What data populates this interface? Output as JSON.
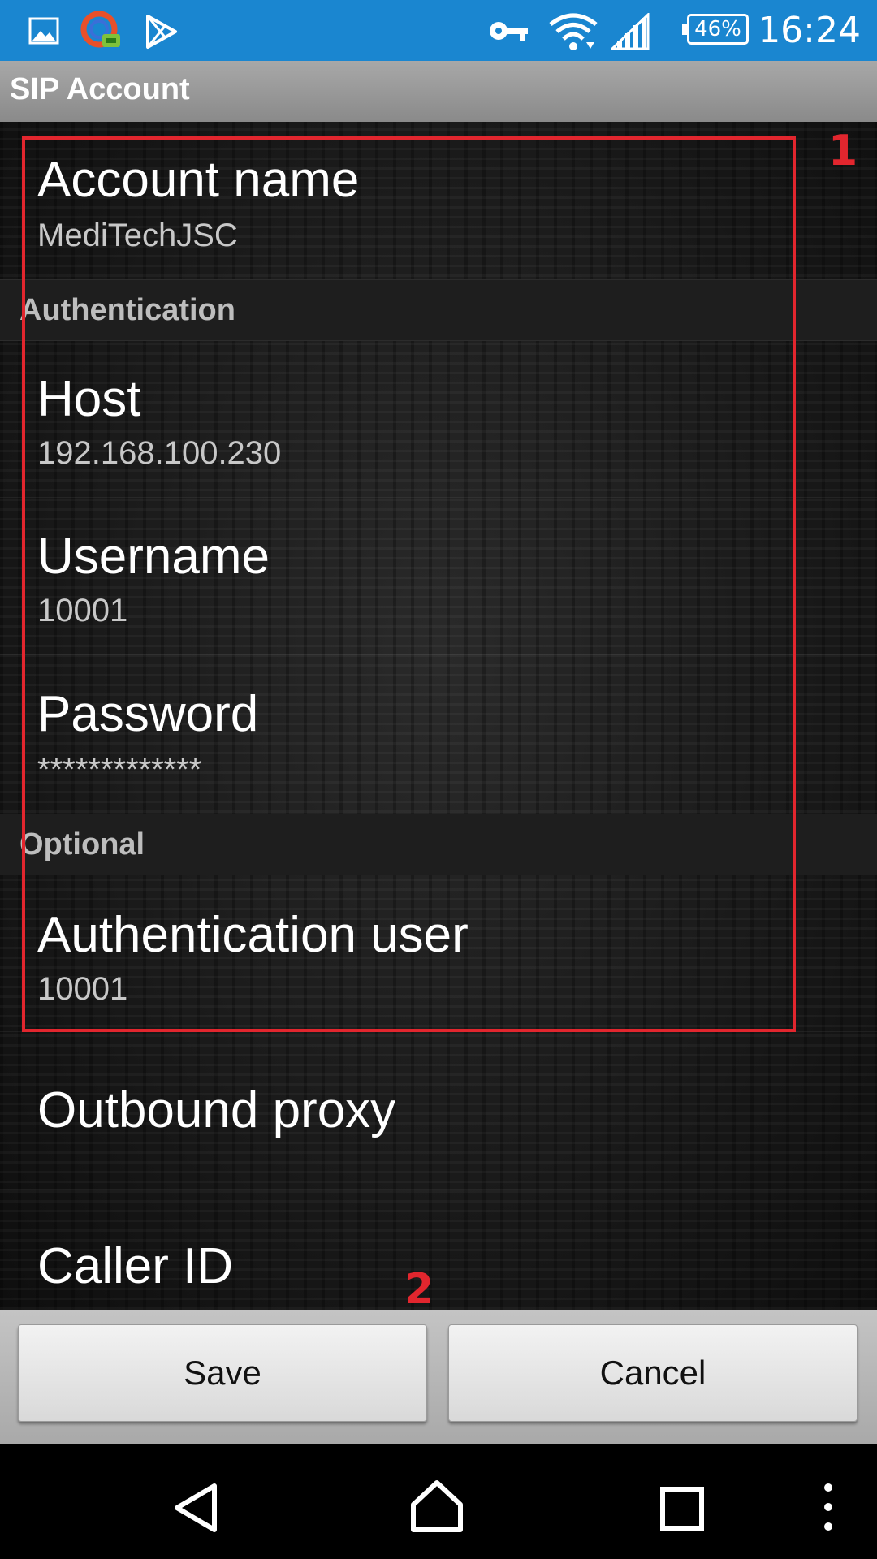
{
  "status_bar": {
    "time": "16:24",
    "battery": "46%",
    "left_icons": [
      "gallery-icon",
      "vpn-app-icon",
      "play-store-icon"
    ],
    "right_icons": [
      "key-icon",
      "wifi-icon",
      "signal-icon",
      "battery-icon"
    ]
  },
  "action_bar": {
    "title": "SIP Account"
  },
  "preferences": {
    "account_name": {
      "title": "Account name",
      "summary": "MediTechJSC"
    },
    "authentication_header": "Authentication",
    "host": {
      "title": "Host",
      "summary": "192.168.100.230"
    },
    "username": {
      "title": "Username",
      "summary": "10001"
    },
    "password": {
      "title": "Password",
      "summary": "*************"
    },
    "optional_header": "Optional",
    "auth_user": {
      "title": "Authentication user",
      "summary": "10001"
    },
    "outbound_proxy": {
      "title": "Outbound proxy"
    },
    "caller_id": {
      "title": "Caller ID"
    }
  },
  "annotations": {
    "box1": "1",
    "box2": "2",
    "color": "#e2262e"
  },
  "buttons": {
    "save": "Save",
    "cancel": "Cancel"
  },
  "nav_bar": [
    "back-icon",
    "home-icon",
    "recents-icon",
    "menu-icon"
  ],
  "colors": {
    "status_bar": "#1a86d0",
    "action_bar": "#9a9a9a"
  }
}
